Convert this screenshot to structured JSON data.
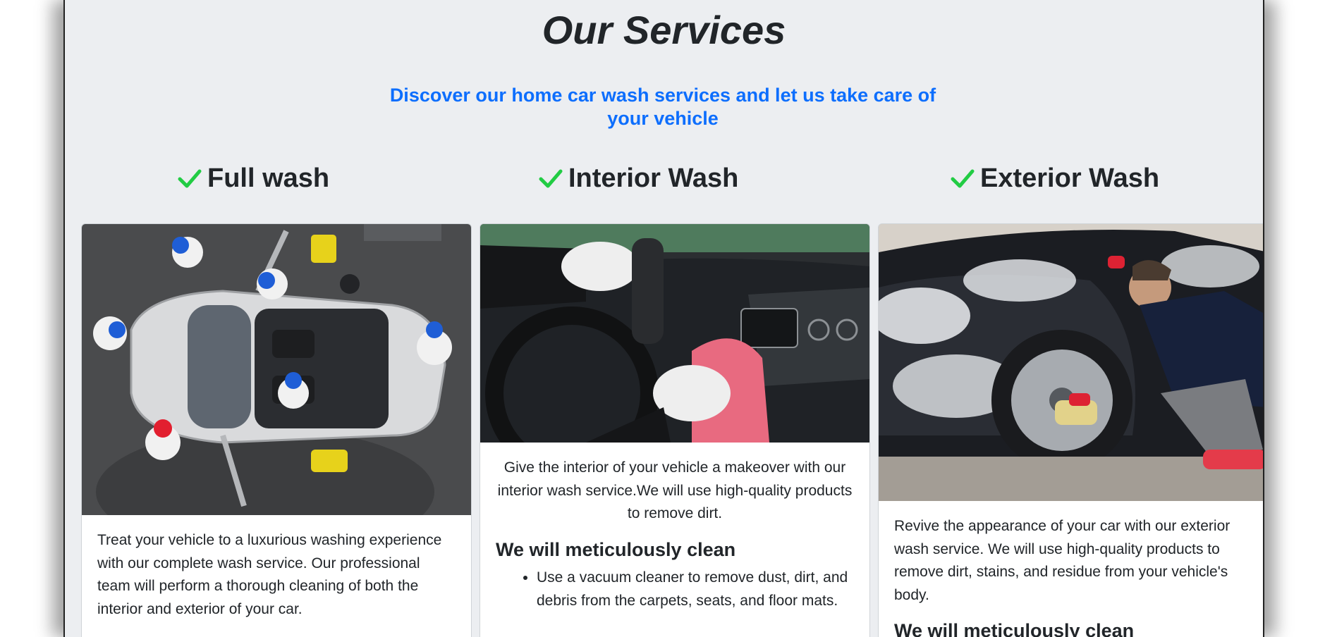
{
  "header": {
    "title": "Our Services",
    "subtitle": "Discover our home car wash services and let us take care of your vehicle"
  },
  "colors": {
    "accent": "#0d6efd",
    "check": "#22cc44",
    "panel_bg": "#eceef1"
  },
  "services": [
    {
      "heading": "Full wash",
      "icon": "check-icon",
      "description": "Treat your vehicle to a luxurious washing experience with our complete wash service. Our professional team will perform a thorough cleaning of both the interior and exterior of your car."
    },
    {
      "heading": "Interior Wash",
      "icon": "check-icon",
      "description": "Give the interior of your vehicle a makeover with our interior wash service.We will use high-quality products to remove dirt.",
      "subheading": "We will meticulously clean",
      "bullets": [
        "Use a vacuum cleaner to remove dust, dirt, and debris from the carpets, seats, and floor mats."
      ]
    },
    {
      "heading": "Exterior Wash",
      "icon": "check-icon",
      "description": "Revive the appearance of your car with our exterior wash service. We will use high-quality products to remove dirt, stains, and residue from your vehicle's body.",
      "subheading": "We will meticulously clean"
    }
  ]
}
